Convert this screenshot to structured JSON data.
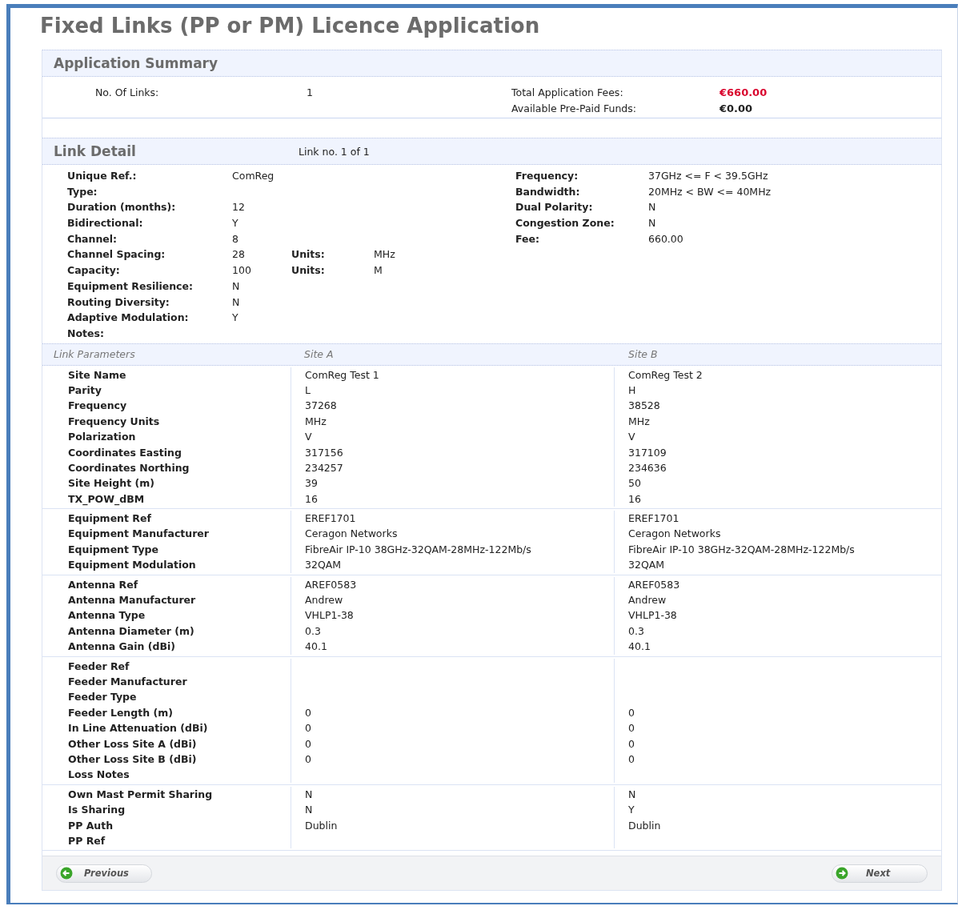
{
  "title": "Fixed Links (PP or PM) Licence Application",
  "summary": {
    "title": "Application Summary",
    "links_label": "No. Of Links:",
    "links_value": "1",
    "fees_label": "Total Application Fees:",
    "fees_value": "€660.00",
    "funds_label": "Available Pre-Paid Funds:",
    "funds_value": "€0.00"
  },
  "link_detail": {
    "title": "Link Detail",
    "link_no": "Link no. 1 of 1",
    "left": [
      {
        "label": "Unique Ref.:",
        "value": "ComReg"
      },
      {
        "label": "Type:"
      },
      {
        "label": "Duration (months):",
        "value": "12"
      },
      {
        "label": "Bidirectional:",
        "value": "Y"
      },
      {
        "label": "Channel:",
        "value": "8"
      },
      {
        "label": "Channel Spacing:",
        "value": "28",
        "units_label": "Units:",
        "units_value": "MHz"
      },
      {
        "label": "Capacity:",
        "value": "100",
        "units_label": "Units:",
        "units_value": "M"
      },
      {
        "label": "Equipment Resilience:",
        "value": "N"
      },
      {
        "label": "Routing Diversity:",
        "value": "N"
      },
      {
        "label": "Adaptive Modulation:",
        "value": "Y"
      },
      {
        "label": "Notes:"
      }
    ],
    "right": [
      {
        "label": "Frequency:",
        "value": "37GHz <= F < 39.5GHz"
      },
      {
        "label": "Bandwidth:",
        "value": "20MHz < BW <= 40MHz"
      },
      {
        "label": "Dual Polarity:",
        "value": "N"
      },
      {
        "label": "Congestion Zone:",
        "value": "N"
      },
      {
        "label": "Fee:",
        "value": "660.00"
      }
    ]
  },
  "params": {
    "columns": [
      "Link Parameters",
      "Site A",
      "Site B"
    ],
    "groups": [
      [
        {
          "label": "Site Name",
          "a": "ComReg Test 1",
          "b": "ComReg Test 2"
        },
        {
          "label": "Parity",
          "a": "L",
          "b": "H"
        },
        {
          "label": "Frequency",
          "a": "37268",
          "b": "38528"
        },
        {
          "label": "Frequency Units",
          "a": "MHz",
          "b": "MHz"
        },
        {
          "label": "Polarization",
          "a": "V",
          "b": "V"
        },
        {
          "label": "Coordinates Easting",
          "a": "317156",
          "b": "317109"
        },
        {
          "label": "Coordinates Northing",
          "a": "234257",
          "b": "234636"
        },
        {
          "label": "Site Height (m)",
          "a": "39",
          "b": "50"
        },
        {
          "label": "TX_POW_dBM",
          "a": "16",
          "b": "16"
        }
      ],
      [
        {
          "label": "Equipment Ref",
          "a": "EREF1701",
          "b": "EREF1701"
        },
        {
          "label": "Equipment Manufacturer",
          "a": "Ceragon Networks",
          "b": "Ceragon Networks"
        },
        {
          "label": "Equipment Type",
          "a": "FibreAir IP-10 38GHz-32QAM-28MHz-122Mb/s",
          "b": "FibreAir IP-10 38GHz-32QAM-28MHz-122Mb/s"
        },
        {
          "label": "Equipment Modulation",
          "a": "32QAM",
          "b": "32QAM"
        }
      ],
      [
        {
          "label": "Antenna Ref",
          "a": "AREF0583",
          "b": "AREF0583"
        },
        {
          "label": "Antenna Manufacturer",
          "a": "Andrew",
          "b": "Andrew"
        },
        {
          "label": "Antenna Type",
          "a": "VHLP1-38",
          "b": "VHLP1-38"
        },
        {
          "label": "Antenna Diameter (m)",
          "a": "0.3",
          "b": "0.3"
        },
        {
          "label": "Antenna Gain (dBi)",
          "a": "40.1",
          "b": "40.1"
        }
      ],
      [
        {
          "label": "Feeder Ref"
        },
        {
          "label": "Feeder Manufacturer"
        },
        {
          "label": "Feeder Type"
        },
        {
          "label": "Feeder Length (m)",
          "a": "0",
          "b": "0"
        },
        {
          "label": "In Line Attenuation (dBi)",
          "a": "0",
          "b": "0"
        },
        {
          "label": "Other Loss Site A (dBi)",
          "a": "0",
          "b": "0"
        },
        {
          "label": "Other Loss Site B (dBi)",
          "a": "0",
          "b": "0"
        },
        {
          "label": "Loss Notes"
        }
      ],
      [
        {
          "label": "Own Mast Permit Sharing",
          "a": "N",
          "b": "N"
        },
        {
          "label": "Is Sharing",
          "a": "N",
          "b": "Y"
        },
        {
          "label": "PP Auth",
          "a": "Dublin",
          "b": "Dublin"
        },
        {
          "label": "PP Ref"
        }
      ]
    ]
  },
  "buttons": {
    "previous": "Previous",
    "next": "Next"
  }
}
